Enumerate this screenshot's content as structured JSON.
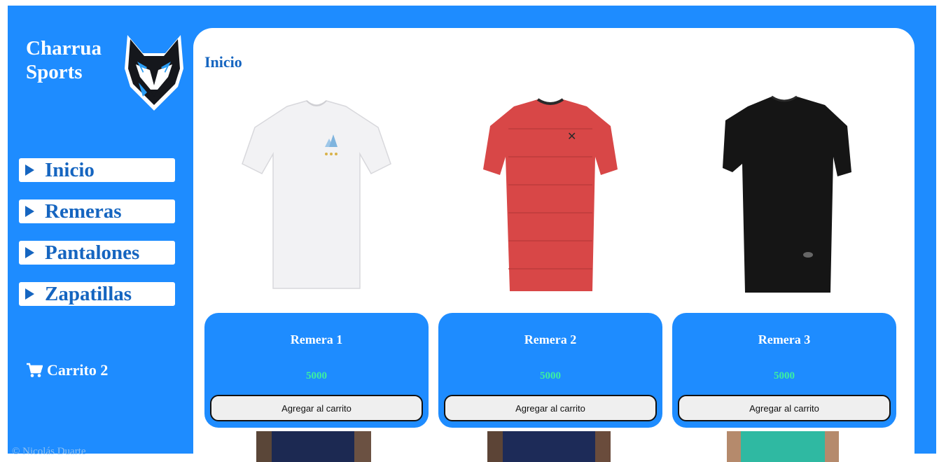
{
  "brand": {
    "line1": "Charrua",
    "line2": "Sports"
  },
  "nav": {
    "items": [
      {
        "label": "Inicio"
      },
      {
        "label": "Remeras"
      },
      {
        "label": "Pantalones"
      },
      {
        "label": "Zapatillas"
      }
    ]
  },
  "cart": {
    "label": "Carrito 2"
  },
  "footer": {
    "text": "© Nicolás Duarte"
  },
  "main": {
    "title": "Inicio",
    "products": [
      {
        "name": "Remera 1",
        "price": "5000",
        "button": "Agregar al carrito",
        "color": "#f2f2f4"
      },
      {
        "name": "Remera 2",
        "price": "5000",
        "button": "Agregar al carrito",
        "color": "#d84747"
      },
      {
        "name": "Remera 3",
        "price": "5000",
        "button": "Agregar al carrito",
        "color": "#151515"
      }
    ]
  },
  "colors": {
    "accent": "#1e8cff",
    "nav_text": "#1565c0",
    "price": "#3cf0a0"
  }
}
